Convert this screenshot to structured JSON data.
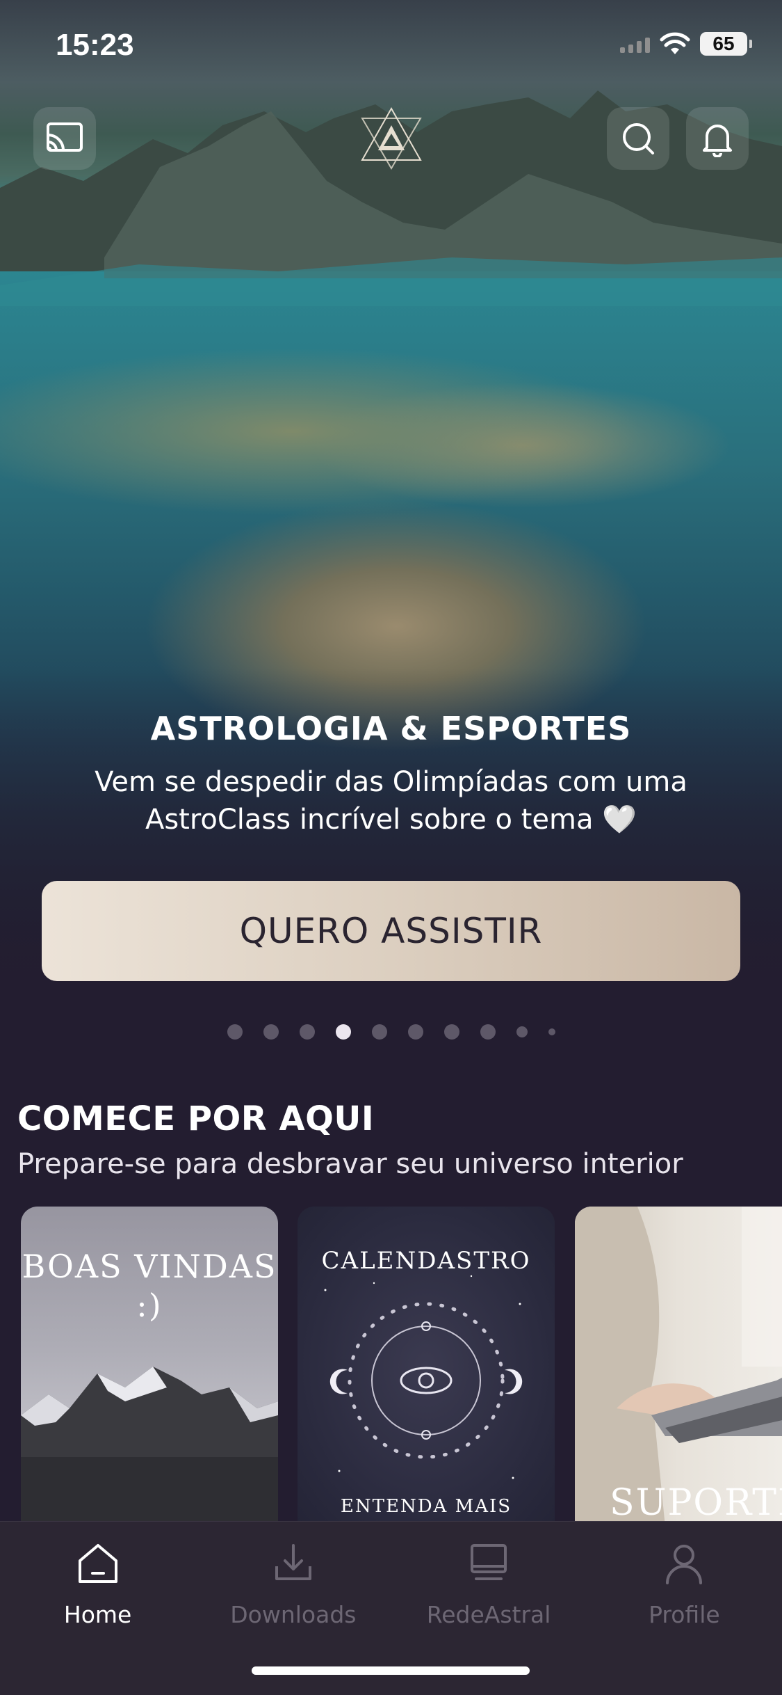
{
  "status_bar": {
    "time": "15:23",
    "battery": "65"
  },
  "header": {
    "icons": [
      "cast-icon",
      "astro-logo",
      "search-icon",
      "bell-icon"
    ]
  },
  "hero": {
    "title": "ASTROLOGIA & ESPORTES",
    "subtitle": "Vem se despedir das Olimpíadas com uma AstroClass incrível sobre o tema 🤍",
    "cta_label": "QUERO ASSISTIR",
    "carousel": {
      "total": 10,
      "active": 4
    }
  },
  "section": {
    "title": "COMECE POR AQUI",
    "subtitle": "Prepare-se para desbravar seu universo interior",
    "cards": [
      {
        "text": "BOAS VINDAS :)"
      },
      {
        "top_text": "CALENDASTRO",
        "bottom_text": "ENTENDA MAIS"
      },
      {
        "text": "SUPORTE"
      }
    ]
  },
  "tabbar": {
    "tabs": [
      {
        "label": "Home",
        "icon": "home-icon",
        "active": true
      },
      {
        "label": "Downloads",
        "icon": "download-icon",
        "active": false
      },
      {
        "label": "RedeAstral",
        "icon": "monitor-icon",
        "active": false
      },
      {
        "label": "Profile",
        "icon": "person-icon",
        "active": false
      }
    ]
  },
  "colors": {
    "background": "#231d30",
    "cta_gradient_start": "#ece3d8",
    "cta_gradient_end": "#c9b7a5",
    "tab_active": "#ffffff",
    "tab_inactive": "#6d6774",
    "dot_active": "#ece6ef",
    "dot_inactive": "#5e5868"
  }
}
